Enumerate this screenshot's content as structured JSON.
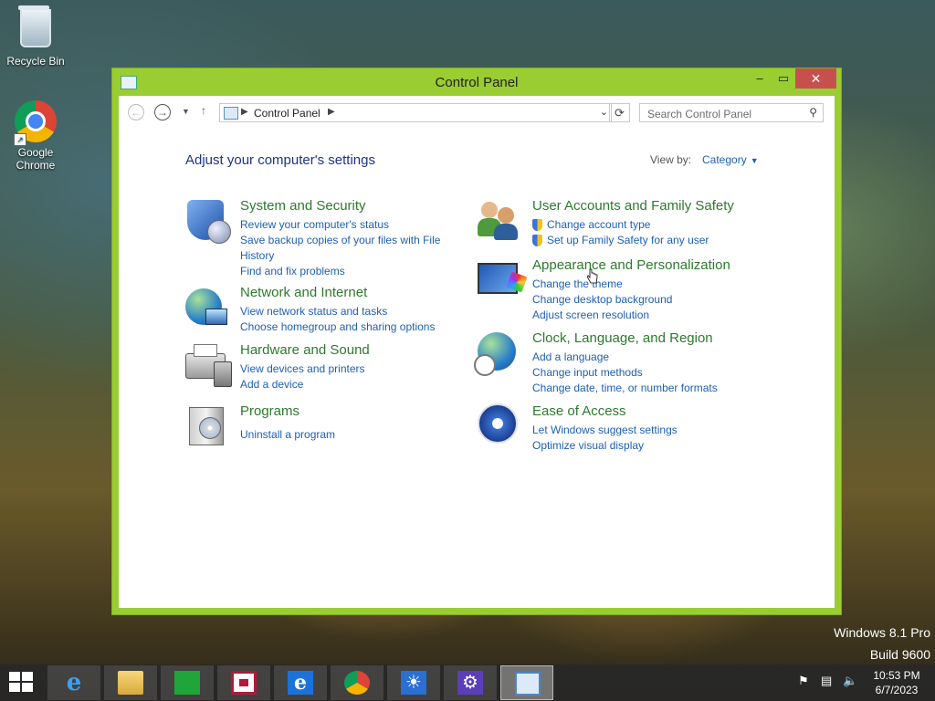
{
  "desktop": {
    "icons": [
      {
        "label": "Recycle Bin"
      },
      {
        "label_line1": "Google",
        "label_line2": "Chrome"
      }
    ],
    "watermark": {
      "line1": "Windows 8.1 Pro",
      "line2": "Build 9600"
    }
  },
  "window": {
    "title": "Control Panel",
    "controls": {
      "minimize": "–",
      "maximize": "▭",
      "close": "✕"
    },
    "address": {
      "crumb": "Control Panel"
    },
    "search": {
      "placeholder": "Search Control Panel"
    },
    "heading": "Adjust your computer's settings",
    "view_by": {
      "label": "View by:",
      "value": "Category"
    },
    "categories": [
      {
        "title": "System and Security",
        "icon": "shield-icon",
        "links": [
          "Review your computer's status",
          "Save backup copies of your files with File History",
          "Find and fix problems"
        ]
      },
      {
        "title": "Network and Internet",
        "icon": "network-icon",
        "links": [
          "View network status and tasks",
          "Choose homegroup and sharing options"
        ]
      },
      {
        "title": "Hardware and Sound",
        "icon": "printer-icon",
        "links": [
          "View devices and printers",
          "Add a device"
        ]
      },
      {
        "title": "Programs",
        "icon": "programs-icon",
        "links": [
          "Uninstall a program"
        ]
      },
      {
        "title": "User Accounts and Family Safety",
        "icon": "users-icon",
        "links": [
          "Change account type",
          "Set up Family Safety for any user"
        ]
      },
      {
        "title": "Appearance and Personalization",
        "icon": "appearance-icon",
        "links": [
          "Change the theme",
          "Change desktop background",
          "Adjust screen resolution"
        ]
      },
      {
        "title": "Clock, Language, and Region",
        "icon": "clock-globe-icon",
        "links": [
          "Add a language",
          "Change input methods",
          "Change date, time, or number formats"
        ]
      },
      {
        "title": "Ease of Access",
        "icon": "ease-of-access-icon",
        "links": [
          "Let Windows suggest settings",
          "Optimize visual display"
        ]
      }
    ]
  },
  "taskbar": {
    "apps": [
      "internet-explorer",
      "file-explorer",
      "store",
      "news",
      "internet-explorer-2",
      "chrome",
      "weather",
      "settings",
      "control-panel"
    ],
    "clock": {
      "time": "10:53 PM",
      "date": "6/7/2023"
    }
  },
  "colors": {
    "window_frame": "#9acd32",
    "link": "#1e5fb4",
    "category_title": "#2d7a2d",
    "heading": "#1e3287",
    "close_button": "#c7504f"
  }
}
